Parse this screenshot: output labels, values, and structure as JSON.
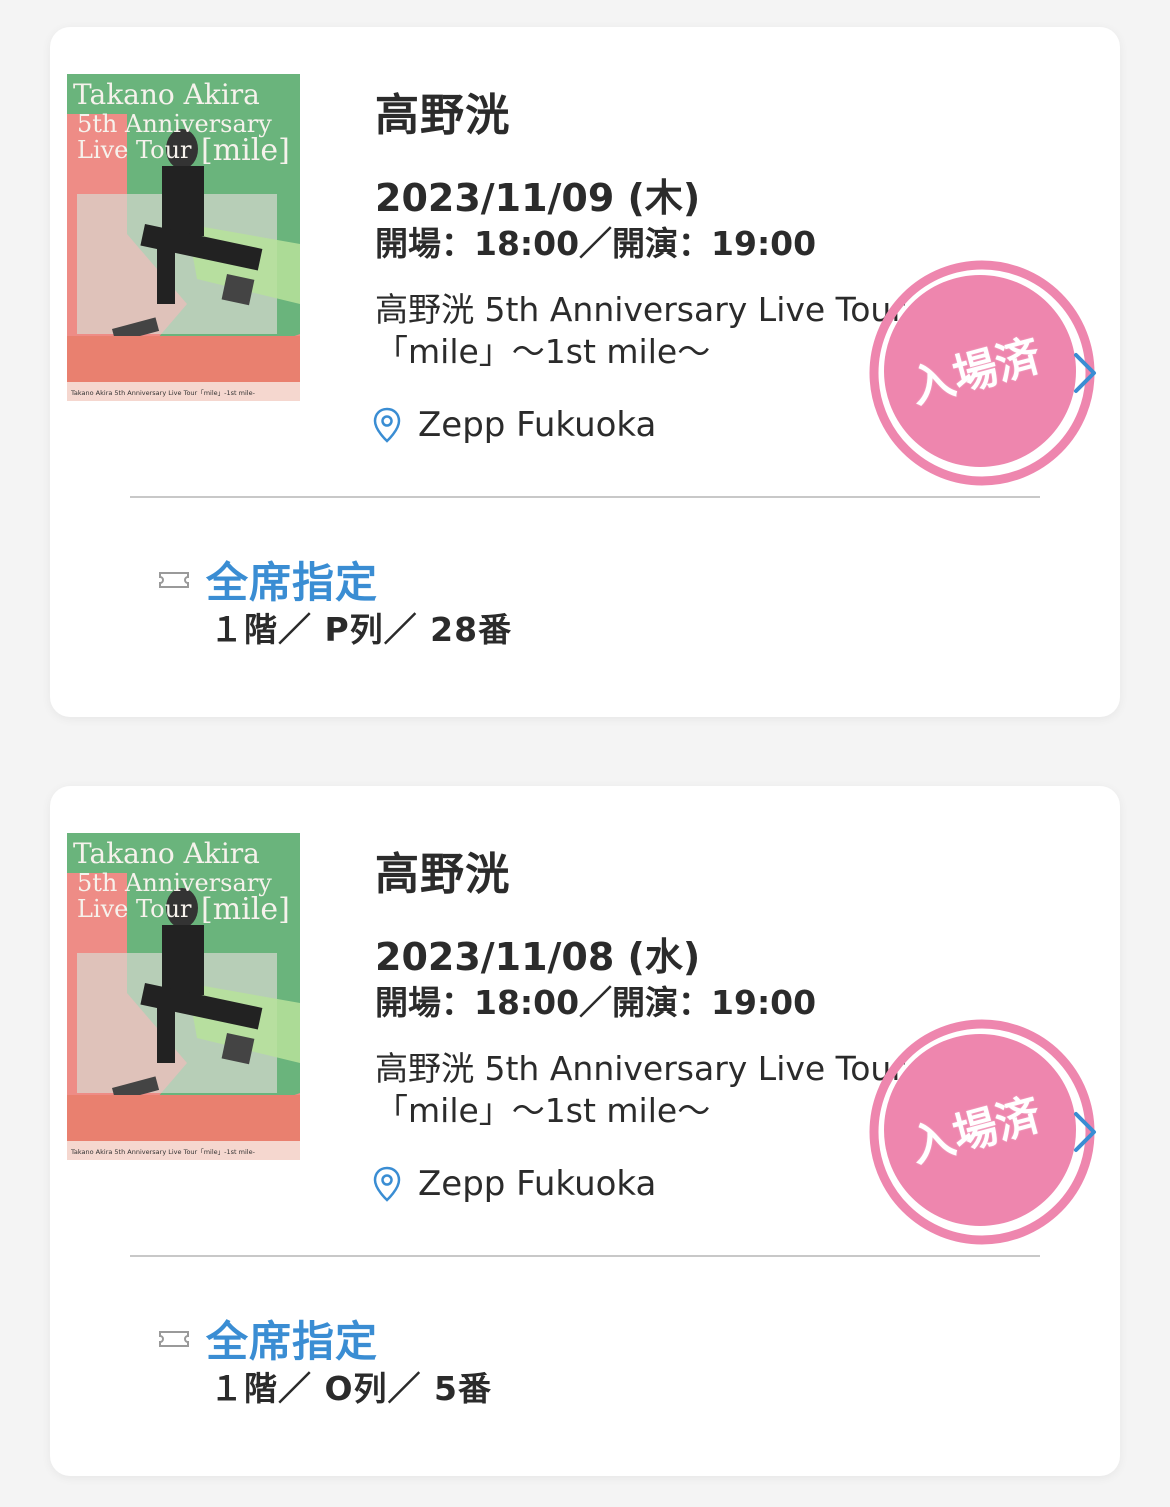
{
  "tickets": [
    {
      "artist": "高野洸",
      "date": "2023/11/09 (木)",
      "times": "開場：18:00／開演：19:00",
      "tour_line1": "高野洸 5th Anniversary Live Tour",
      "tour_line2": "「mile」〜1st mile〜",
      "venue": "Zepp Fukuoka",
      "stamp": "入場済",
      "seat_type": "全席指定",
      "seat_info": "１階／ P列／ 28番",
      "poster_title": "Takano Akira",
      "poster_sub1": "5th Anniversary",
      "poster_sub2": "Live Tour",
      "poster_mile": "[mile]",
      "poster_footer": "Takano Akira 5th Anniversary Live Tour「mile」-1st mile-"
    },
    {
      "artist": "高野洸",
      "date": "2023/11/08 (水)",
      "times": "開場：18:00／開演：19:00",
      "tour_line1": "高野洸 5th Anniversary Live Tour",
      "tour_line2": "「mile」〜1st mile〜",
      "venue": "Zepp Fukuoka",
      "stamp": "入場済",
      "seat_type": "全席指定",
      "seat_info": "１階／ O列／ 5番",
      "poster_title": "Takano Akira",
      "poster_sub1": "5th Anniversary",
      "poster_sub2": "Live Tour",
      "poster_mile": "[mile]",
      "poster_footer": "Takano Akira 5th Anniversary Live Tour「mile」-1st mile-"
    }
  ],
  "colors": {
    "stamp_pink": "#ee86ae",
    "accent_blue": "#3a8dd3",
    "poster_green": "#6ab47c",
    "poster_salmon": "#ee8c86"
  },
  "icons": {
    "venue": "map-pin-icon",
    "seat": "ticket-icon",
    "open": "chevron-right-icon"
  }
}
